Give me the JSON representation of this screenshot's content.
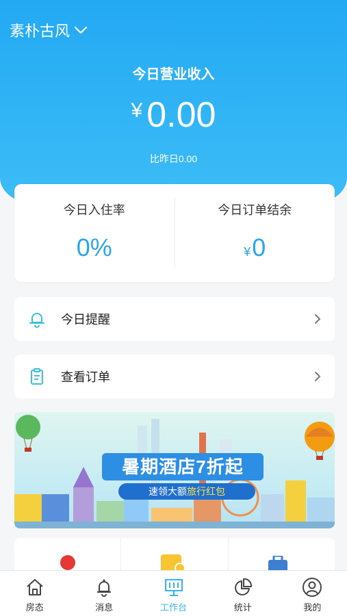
{
  "header": {
    "shop_name": "素朴古风",
    "revenue_title": "今日营业收入",
    "currency": "¥",
    "revenue_amount": "0.00",
    "compare_text": "比昨日0.00"
  },
  "stats": {
    "occupancy_label": "今日入住率",
    "occupancy_value": "0%",
    "balance_label": "今日订单结余",
    "balance_currency": "¥",
    "balance_value": "0"
  },
  "rows": {
    "reminder_label": "今日提醒",
    "orders_label": "查看订单"
  },
  "banner": {
    "title": "暑期酒店7折起",
    "sub_prefix": "速领大额",
    "sub_highlight": "旅行红包"
  },
  "tabs": [
    {
      "label": "房态",
      "icon": "house-icon"
    },
    {
      "label": "消息",
      "icon": "bell-icon"
    },
    {
      "label": "工作台",
      "icon": "workbench-icon",
      "active": true
    },
    {
      "label": "统计",
      "icon": "pie-chart-icon"
    },
    {
      "label": "我的",
      "icon": "user-icon"
    }
  ],
  "colors": {
    "brand_blue": "#2aa7e8",
    "tab_active": "#35b6f0"
  }
}
